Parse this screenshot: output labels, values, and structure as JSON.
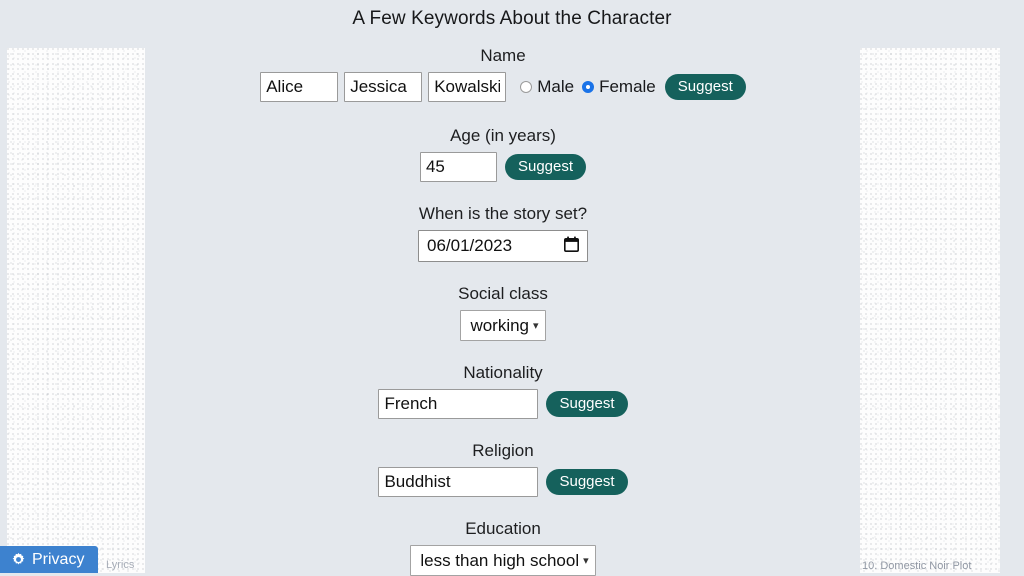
{
  "page": {
    "title": "A Few Keywords About the Character",
    "background_color": "#e4e8ed",
    "accent_color": "#15615c",
    "radio_selected_color": "#1a73e8"
  },
  "ads": {
    "left_caption": "Lyrics",
    "right_caption": "10. Domestic Noir Plot"
  },
  "form": {
    "name": {
      "label": "Name",
      "first_value": "Alice",
      "middle_value": "Jessica",
      "last_value": "Kowalski",
      "gender_options": [
        {
          "label": "Male",
          "selected": false
        },
        {
          "label": "Female",
          "selected": true
        }
      ],
      "male_label": "Male",
      "female_label": "Female",
      "suggest_label": "Suggest"
    },
    "age": {
      "label": "Age (in years)",
      "value": "45",
      "suggest_label": "Suggest"
    },
    "story_date": {
      "label": "When is the story set?",
      "value": "06/01/2023",
      "picker_icon": "calendar-icon"
    },
    "social_class": {
      "label": "Social class",
      "value": "working",
      "caret_icon": "chevron-down-icon"
    },
    "nationality": {
      "label": "Nationality",
      "value": "French",
      "suggest_label": "Suggest"
    },
    "religion": {
      "label": "Religion",
      "value": "Buddhist",
      "suggest_label": "Suggest"
    },
    "education": {
      "label": "Education",
      "value": "less than high school",
      "caret_icon": "chevron-down-icon"
    }
  },
  "privacy": {
    "label": "Privacy",
    "icon": "gear-icon",
    "color": "#3d82cf"
  }
}
